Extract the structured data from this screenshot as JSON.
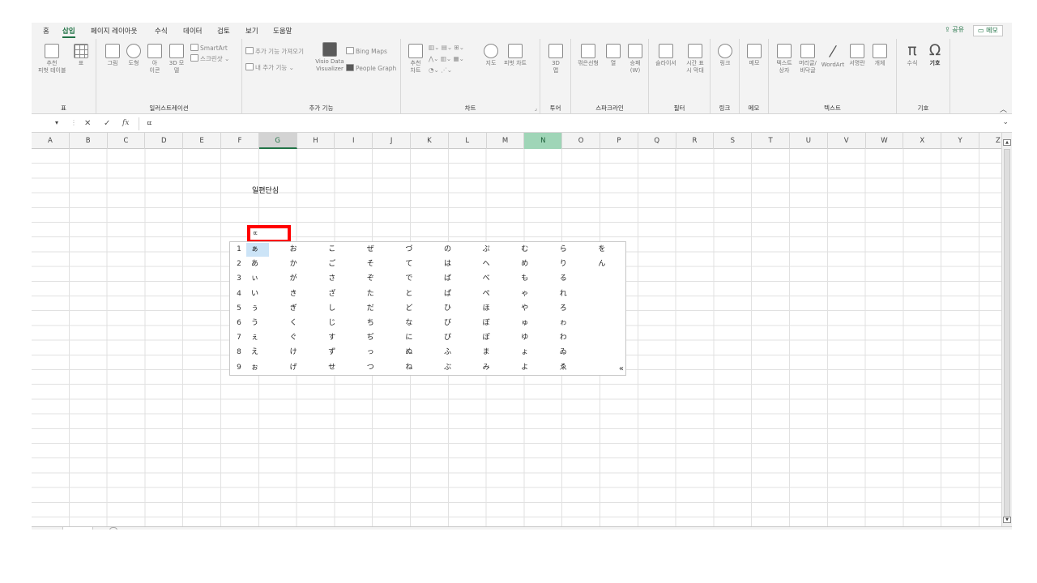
{
  "ribbon_tabs": {
    "items": [
      "홈",
      "삽입",
      "페이지 레이아웃",
      "수식",
      "데이터",
      "검토",
      "보기",
      "도움말"
    ],
    "active": "삽입",
    "share_label": "공유",
    "memo_label": "메모"
  },
  "ribbon": {
    "groups": {
      "table": {
        "label": "표",
        "recommended_pivot": "추천\n피벗 테이블",
        "table": "표"
      },
      "illustrations": {
        "label": "일러스트레이션",
        "picture": "그림",
        "shapes": "도형",
        "icons": "아\n이콘",
        "models_3d": "3D 모\n델",
        "smartart": "SmartArt",
        "screenshot": "스크린샷"
      },
      "addins": {
        "label": "추가 기능",
        "get_addins": "추가 기능 가져오기",
        "my_addins": "내 추가 기능",
        "visio": "Visio Data\nVisualizer",
        "bing_maps": "Bing Maps",
        "people_graph": "People Graph"
      },
      "charts": {
        "label": "차트",
        "recommended": "추천\n차트",
        "maps": "지도",
        "pivot_chart": "피벗 차트"
      },
      "tours": {
        "label": "투어",
        "map_3d": "3D\n맵"
      },
      "sparklines": {
        "label": "스파크라인",
        "line": "꺾은선형",
        "column": "열",
        "win_loss": "승패\n(W)"
      },
      "filters": {
        "label": "필터",
        "slicer": "슬라이서",
        "timeline": "시간 표\n시 막대"
      },
      "links": {
        "label": "링크",
        "link": "링크"
      },
      "comments": {
        "label": "메모",
        "memo": "메모"
      },
      "text": {
        "label": "텍스트",
        "textbox": "텍스트\n상자",
        "header_footer": "머리글/\n바닥글",
        "wordart": "WordArt",
        "signature": "서명란",
        "object": "개체"
      },
      "symbols": {
        "label": "기호",
        "equation": "수식",
        "symbol": "기호"
      }
    }
  },
  "formula_bar": {
    "fx": "fx",
    "content": "ㄸ"
  },
  "columns": [
    "A",
    "B",
    "C",
    "D",
    "E",
    "F",
    "G",
    "H",
    "I",
    "J",
    "K",
    "L",
    "M",
    "N",
    "O",
    "P",
    "Q",
    "R",
    "S",
    "T",
    "U",
    "V",
    "W",
    "X",
    "Y",
    "Z"
  ],
  "highlighted_columns": [
    "G",
    "N"
  ],
  "cells": {
    "g3": "일편단심",
    "active_cell": "ㄸ"
  },
  "ime_candidates": {
    "row_numbers": [
      "1",
      "2",
      "3",
      "4",
      "5",
      "6",
      "7",
      "8",
      "9"
    ],
    "columns": [
      [
        "ぁ",
        "あ",
        "ぃ",
        "い",
        "ぅ",
        "う",
        "ぇ",
        "え",
        "ぉ"
      ],
      [
        "お",
        "か",
        "が",
        "き",
        "ぎ",
        "く",
        "ぐ",
        "け",
        "げ"
      ],
      [
        "こ",
        "ご",
        "さ",
        "ざ",
        "し",
        "じ",
        "す",
        "ず",
        "せ"
      ],
      [
        "ぜ",
        "そ",
        "ぞ",
        "た",
        "だ",
        "ち",
        "ぢ",
        "っ",
        "つ"
      ],
      [
        "づ",
        "て",
        "で",
        "と",
        "ど",
        "な",
        "に",
        "ぬ",
        "ね"
      ],
      [
        "の",
        "は",
        "ば",
        "ぱ",
        "ひ",
        "び",
        "ぴ",
        "ふ",
        "ぶ"
      ],
      [
        "ぷ",
        "へ",
        "べ",
        "ぺ",
        "ほ",
        "ぼ",
        "ぽ",
        "ま",
        "み"
      ],
      [
        "む",
        "め",
        "も",
        "ゃ",
        "や",
        "ゅ",
        "ゆ",
        "ょ",
        "よ"
      ],
      [
        "ら",
        "り",
        "る",
        "れ",
        "ろ",
        "ゎ",
        "わ",
        "ゐ",
        "ゑ"
      ],
      [
        "を",
        "ん"
      ]
    ],
    "expand_label": "«"
  },
  "colors": {
    "accent": "#217346",
    "highlight_column": "#9fd5b7",
    "selection": "#cce4f7",
    "active_cell_border": "#ff0000"
  }
}
